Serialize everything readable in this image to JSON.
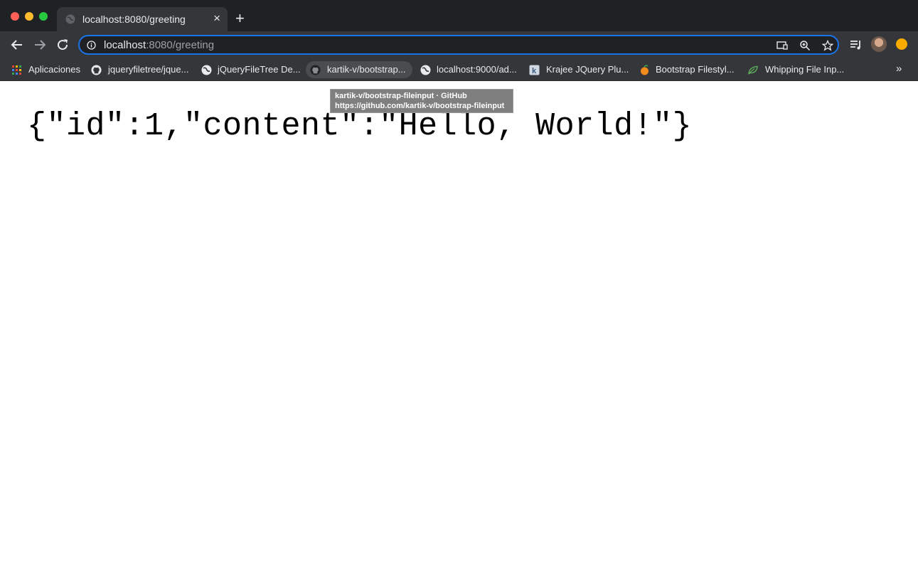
{
  "window": {
    "tab": {
      "title": "localhost:8080/greeting",
      "close": "×"
    },
    "new_tab": "+"
  },
  "toolbar": {
    "url_host": "localhost",
    "url_rest": ":8080/greeting",
    "icons": [
      "back-icon",
      "forward-icon",
      "reload-icon",
      "info-icon",
      "cast-icon",
      "zoom-icon",
      "star-icon",
      "media-icon",
      "avatar",
      "extension-icon"
    ]
  },
  "bookmarks": {
    "items": [
      {
        "label": "Aplicaciones",
        "icon": "apps-grid-icon"
      },
      {
        "label": "jqueryfiletree/jque...",
        "icon": "github-icon"
      },
      {
        "label": "jQueryFileTree De...",
        "icon": "globe-icon"
      },
      {
        "label": "kartik-v/bootstrap...",
        "icon": "github-icon"
      },
      {
        "label": "localhost:9000/ad...",
        "icon": "globe-icon"
      },
      {
        "label": "Krajee JQuery Plu...",
        "icon": "krajee-k-icon"
      },
      {
        "label": "Bootstrap Filestyl...",
        "icon": "orange-fruit-icon"
      },
      {
        "label": "Whipping File Inp...",
        "icon": "leaf-icon"
      }
    ],
    "more": "»"
  },
  "tooltip": {
    "line1": "kartik-v/bootstrap-fileinput · GitHub",
    "line2": "https://github.com/kartik-v/bootstrap-fileinput"
  },
  "page": {
    "body_text": "{\"id\":1,\"content\":\"Hello, World!\"}"
  }
}
